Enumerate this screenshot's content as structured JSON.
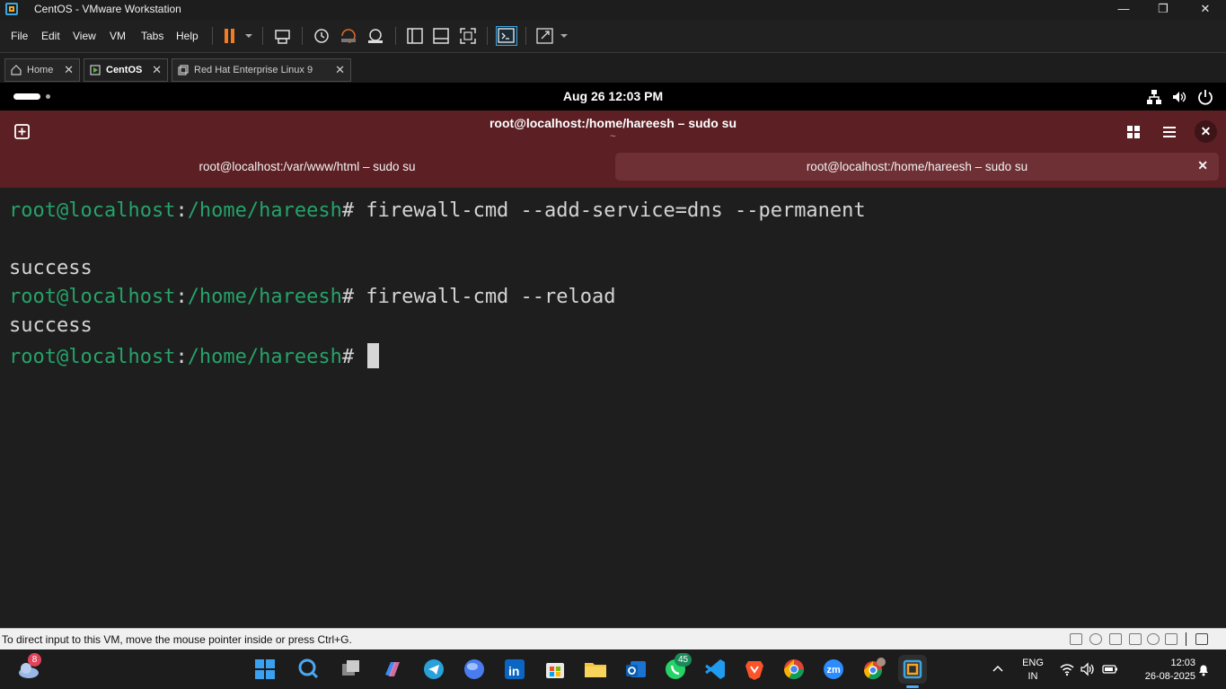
{
  "window": {
    "title": "CentOS - VMware Workstation",
    "minimize_glyph": "—",
    "restore_glyph": "❐",
    "close_glyph": "✕"
  },
  "menu": {
    "file": "File",
    "edit": "Edit",
    "view": "View",
    "vm": "VM",
    "tabs": "Tabs",
    "help": "Help"
  },
  "vm_tabs": [
    {
      "label": "Home",
      "close": "✕"
    },
    {
      "label": "CentOS",
      "close": "✕"
    },
    {
      "label": "Red Hat Enterprise Linux 9",
      "close": "✕"
    }
  ],
  "gnome": {
    "clock": "Aug 26  12:03 PM"
  },
  "terminal": {
    "header_title": "root@localhost:/home/hareesh – sudo su",
    "header_subtitle": "~",
    "tabs": [
      {
        "label": "root@localhost:/var/www/html – sudo su"
      },
      {
        "label": "root@localhost:/home/hareesh – sudo su",
        "close": "✕"
      }
    ],
    "close_glyph": "✕",
    "lines": [
      {
        "user": "root@localhost",
        "sep": ":",
        "path": "/home/hareesh",
        "cmd": "# firewall-cmd --add-service=dns --permanent"
      },
      {
        "output": "success"
      },
      {
        "user": "root@localhost",
        "sep": ":",
        "path": "/home/hareesh",
        "cmd": "# firewall-cmd --reload"
      },
      {
        "output": "success"
      },
      {
        "user": "root@localhost",
        "sep": ":",
        "path": "/home/hareesh",
        "cmd": "# "
      }
    ]
  },
  "statusbar": {
    "message": "To direct input to this VM, move the mouse pointer inside or press Ctrl+G."
  },
  "taskbar": {
    "weather_badge": "8",
    "whatsapp_badge": "45",
    "lang_top": "ENG",
    "lang_bottom": "IN",
    "time": "12:03",
    "date": "26-08-2025",
    "zoom_label": "zm"
  },
  "colors": {
    "terminal_header": "#5c1f24",
    "prompt": "#26a269",
    "terminal_bg": "#1e1e1e",
    "accent_blue": "#3da5e0",
    "pause_orange": "#f47b20"
  }
}
